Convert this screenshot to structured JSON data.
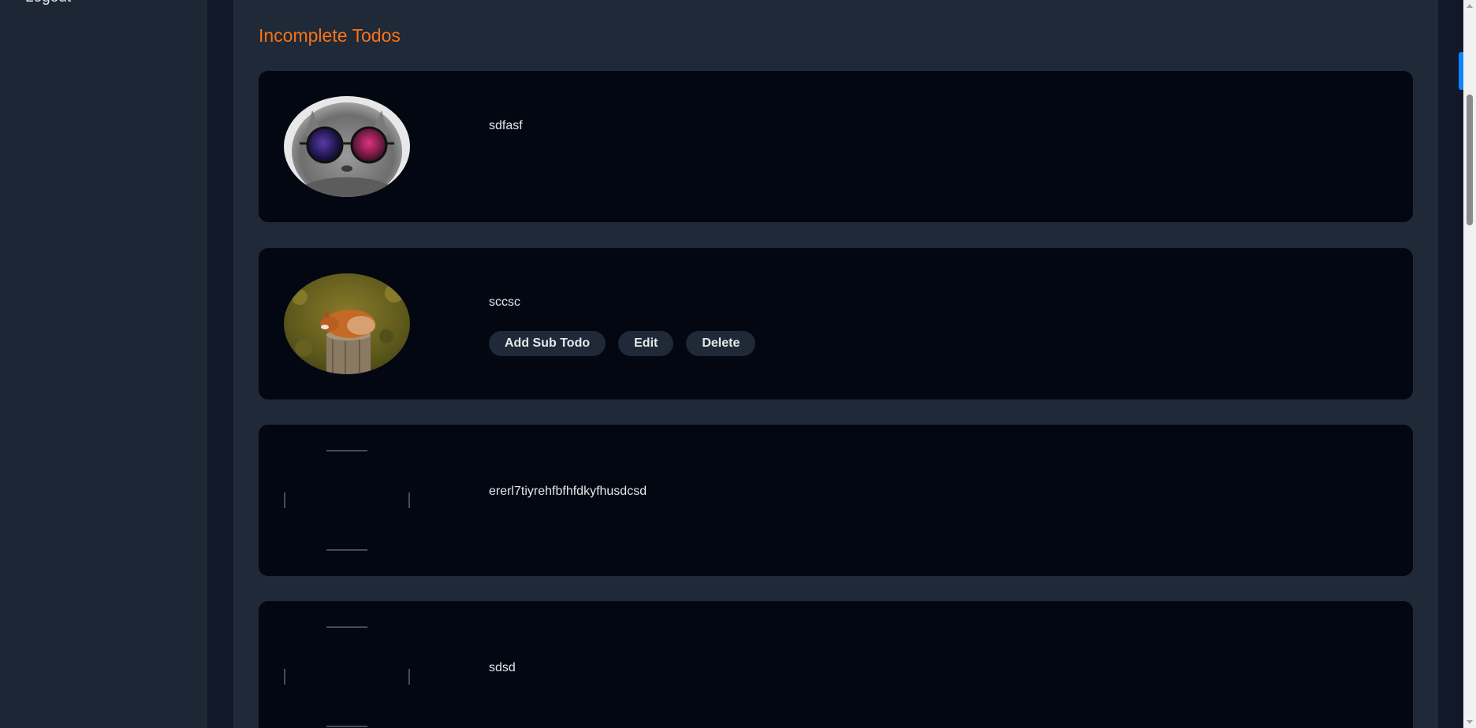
{
  "sidebar": {
    "logout_label": "Logout"
  },
  "main": {
    "section_title": "Incomplete Todos",
    "todos": [
      {
        "text": "sdfasf",
        "image": "cat-with-sunglasses",
        "show_actions": false
      },
      {
        "text": "sccsc",
        "image": "fox-on-stump",
        "show_actions": true
      },
      {
        "text": "ererl7tiyrehfbfhfdkyfhusdcsd",
        "image": "broken-image",
        "show_actions": false
      },
      {
        "text": "sdsd",
        "image": "broken-image",
        "show_actions": false
      }
    ],
    "actions": {
      "add_sub_todo_label": "Add Sub Todo",
      "edit_label": "Edit",
      "delete_label": "Delete"
    }
  },
  "colors": {
    "accent": "#f97316",
    "card_bg": "#030712",
    "panel_bg": "#1f2937",
    "button_bg": "#1f2937",
    "scroll_indicator": "#0a84ff"
  }
}
